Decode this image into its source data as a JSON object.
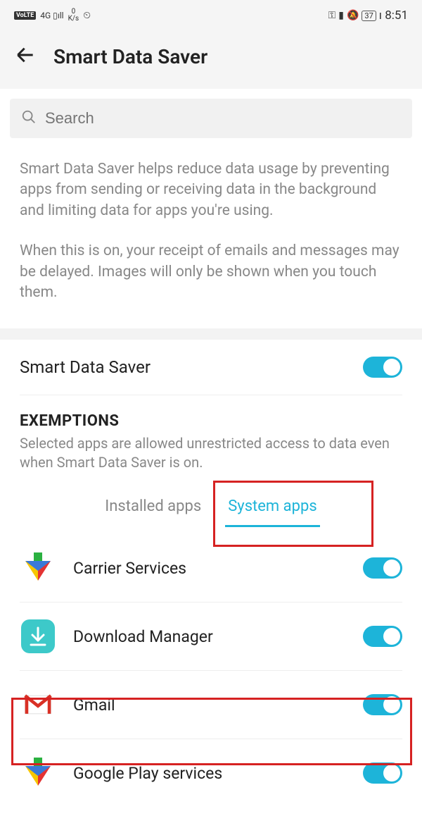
{
  "status": {
    "volte": "VoLTE",
    "signal": "4G",
    "speed_top": "0",
    "speed_unit": "K/s",
    "battery": "37",
    "time": "8:51"
  },
  "header": {
    "title": "Smart Data Saver"
  },
  "search": {
    "placeholder": "Search"
  },
  "description": {
    "p1": "Smart Data Saver helps reduce data usage by preventing apps from sending or receiving data in the background and limiting data for apps you're using.",
    "p2": "When this is on, your receipt of emails and messages may be delayed. Images will only be shown when you touch them."
  },
  "main_toggle": {
    "label": "Smart Data Saver"
  },
  "exemptions": {
    "title": "EXEMPTIONS",
    "subtitle": "Selected apps are allowed unrestricted access to data even when Smart Data Saver is on.",
    "tabs": {
      "installed": "Installed apps",
      "system": "System apps"
    },
    "apps": [
      {
        "name": "Carrier Services"
      },
      {
        "name": "Download Manager"
      },
      {
        "name": "Gmail"
      },
      {
        "name": "Google Play services"
      }
    ]
  }
}
